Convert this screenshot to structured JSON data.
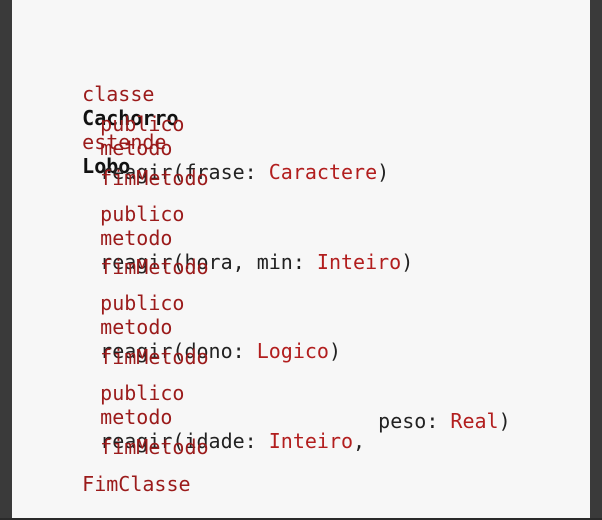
{
  "code": {
    "line1": {
      "kw1": "classe",
      "name1": "Cachorro",
      "kw2": "estende",
      "name2": "Lobo"
    },
    "line2": {
      "kw1": "publico",
      "kw2": "metodo",
      "sig": "reagir(frase: ",
      "type": "Caractere",
      "end": ")"
    },
    "line3": {
      "kw": "fimMetodo"
    },
    "line4": {
      "kw1": "publico",
      "kw2": "metodo",
      "sig": "reagir(hora, min: ",
      "type": "Inteiro",
      "end": ")"
    },
    "line5": {
      "kw": "fimMetodo"
    },
    "line6": {
      "kw1": "publico",
      "kw2": "metodo",
      "sig": "reagir(dono: ",
      "type": "Logico",
      "end": ")"
    },
    "line7": {
      "kw": "fimMetodo"
    },
    "line8": {
      "kw1": "publico",
      "kw2": "metodo",
      "sig": "reagir(idade: ",
      "type": "Inteiro",
      "end": ","
    },
    "line9": {
      "sig": "peso: ",
      "type": "Real",
      "end": ")"
    },
    "line10": {
      "kw": "fimMetodo"
    },
    "line11": {
      "kw": "FimClasse"
    }
  }
}
